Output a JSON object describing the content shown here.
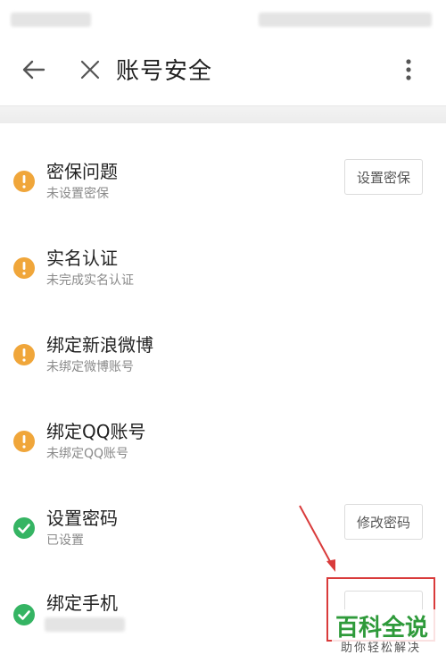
{
  "nav": {
    "title": "账号安全"
  },
  "items": [
    {
      "title": "密保问题",
      "subtitle": "未设置密保",
      "status": "warning",
      "button": "设置密保"
    },
    {
      "title": "实名认证",
      "subtitle": "未完成实名认证",
      "status": "warning"
    },
    {
      "title": "绑定新浪微博",
      "subtitle": "未绑定微博账号",
      "status": "warning"
    },
    {
      "title": "绑定QQ账号",
      "subtitle": "未绑定QQ账号",
      "status": "warning"
    },
    {
      "title": "设置密码",
      "subtitle": "已设置",
      "status": "ok",
      "button": "修改密码"
    },
    {
      "title": "绑定手机",
      "subtitle": "",
      "status": "ok",
      "button": ""
    }
  ],
  "watermark": {
    "title": "百科全说",
    "subtitle": "助你轻松解决"
  },
  "colors": {
    "warning": "#f0a63a",
    "ok": "#35b463",
    "annotation": "#d93b3b",
    "watermark": "#2e9a3a"
  },
  "icons": {
    "back": "arrow-left-icon",
    "close": "close-icon",
    "more": "more-vertical-icon",
    "warning": "exclamation-circle-icon",
    "ok": "check-circle-icon"
  }
}
